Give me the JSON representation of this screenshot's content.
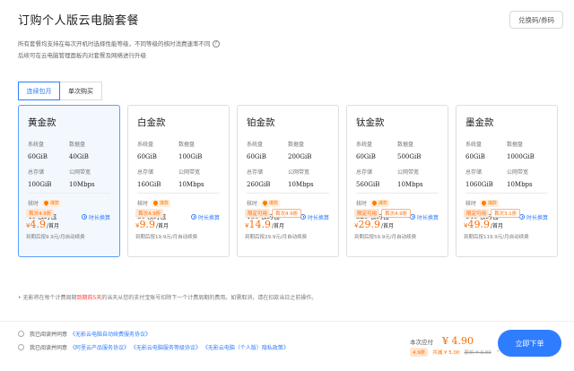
{
  "header": {
    "title": "订购个人版云电脑套餐",
    "redeem_label": "兑换码/券码"
  },
  "intro": {
    "line1": "所有套餐均支持在每次开机时选择性能等级，不同等级的核时消费速率不同",
    "help_icon": "?",
    "line2": "后续可在云电脑管理面板内对套餐及网络进行升级"
  },
  "tabs": [
    {
      "label": "连续包月",
      "active": true
    },
    {
      "label": "单次购买",
      "active": false
    }
  ],
  "spec_labels": {
    "system_disk": "系统盘",
    "data_disk": "数据盘",
    "total_storage": "总存储",
    "bandwidth": "公网带宽",
    "duration": "核时",
    "fire_badge": "爆款",
    "per_hour": "时长换算",
    "per_month": "/首月"
  },
  "plans": [
    {
      "name": "黄金款",
      "system_disk": "60GiB",
      "data_disk": "40GiB",
      "total_storage": "100GiB",
      "bandwidth": "10Mbps",
      "duration": "40 核时包",
      "tags": [
        "首次4.9折"
      ],
      "currency": "¥",
      "price": "4.9",
      "renew": "到期后按9.9元/月自动续费"
    },
    {
      "name": "白金款",
      "system_disk": "60GiB",
      "data_disk": "100GiB",
      "total_storage": "160GiB",
      "bandwidth": "10Mbps",
      "duration": "80 核时包",
      "tags": [
        "首次4.9折"
      ],
      "currency": "¥",
      "price": "9.9",
      "renew": "到期后按19.9元/月自动续费"
    },
    {
      "name": "铂金款",
      "system_disk": "60GiB",
      "data_disk": "200GiB",
      "total_storage": "260GiB",
      "bandwidth": "10Mbps",
      "duration": "160 核时包",
      "tags": [
        "限定可用",
        "首次4.9折"
      ],
      "currency": "¥",
      "price": "14.9",
      "renew": "到期后按29.9元/月自动续费"
    },
    {
      "name": "钛金款",
      "system_disk": "60GiB",
      "data_disk": "500GiB",
      "total_storage": "560GiB",
      "bandwidth": "10Mbps",
      "duration": "320 核时包",
      "tags": [
        "限定可用",
        "首次4.9折"
      ],
      "currency": "¥",
      "price": "29.9",
      "renew": "到期后按59.9元/月自动续费"
    },
    {
      "name": "墨金款",
      "system_disk": "60GiB",
      "data_disk": "1000GiB",
      "total_storage": "1060GiB",
      "bandwidth": "10Mbps",
      "duration": "640 核时包",
      "tags": [
        "限定可用",
        "首次3.1折"
      ],
      "currency": "¥",
      "price": "49.9",
      "renew": "到期后按119.9元/月自动续费"
    }
  ],
  "note": {
    "prefix": "• 无影将在每个计费周期",
    "highlight": "到期前5天",
    "suffix": "的当天从您的支付宝账号扣除下一个计费周期的费用。如需取消，请在扣款当日之前操作。"
  },
  "footer": {
    "agree1_prefix": "我已阅读并同意",
    "agree1_link": "《无影云电脑自动续费服务协议》",
    "agree2_prefix": "我已阅读并同意",
    "agree2_link": "《阿里云产品服务协议》 《无影云电脑服务等级协议》 《无影云电脑（个人版）隐私政策》",
    "total_label": "本次应付",
    "total_price": "¥ 4.90",
    "discount_tag": "4.9折",
    "saved": "共减 ¥ 5.00",
    "original": "原价 ¥ 9.90",
    "caret": "⌃",
    "buy_label": "立即下单"
  },
  "colors": {
    "accent": "#2f7dff",
    "price": "#ff6a00",
    "highlight_red": "#ff3b30"
  }
}
